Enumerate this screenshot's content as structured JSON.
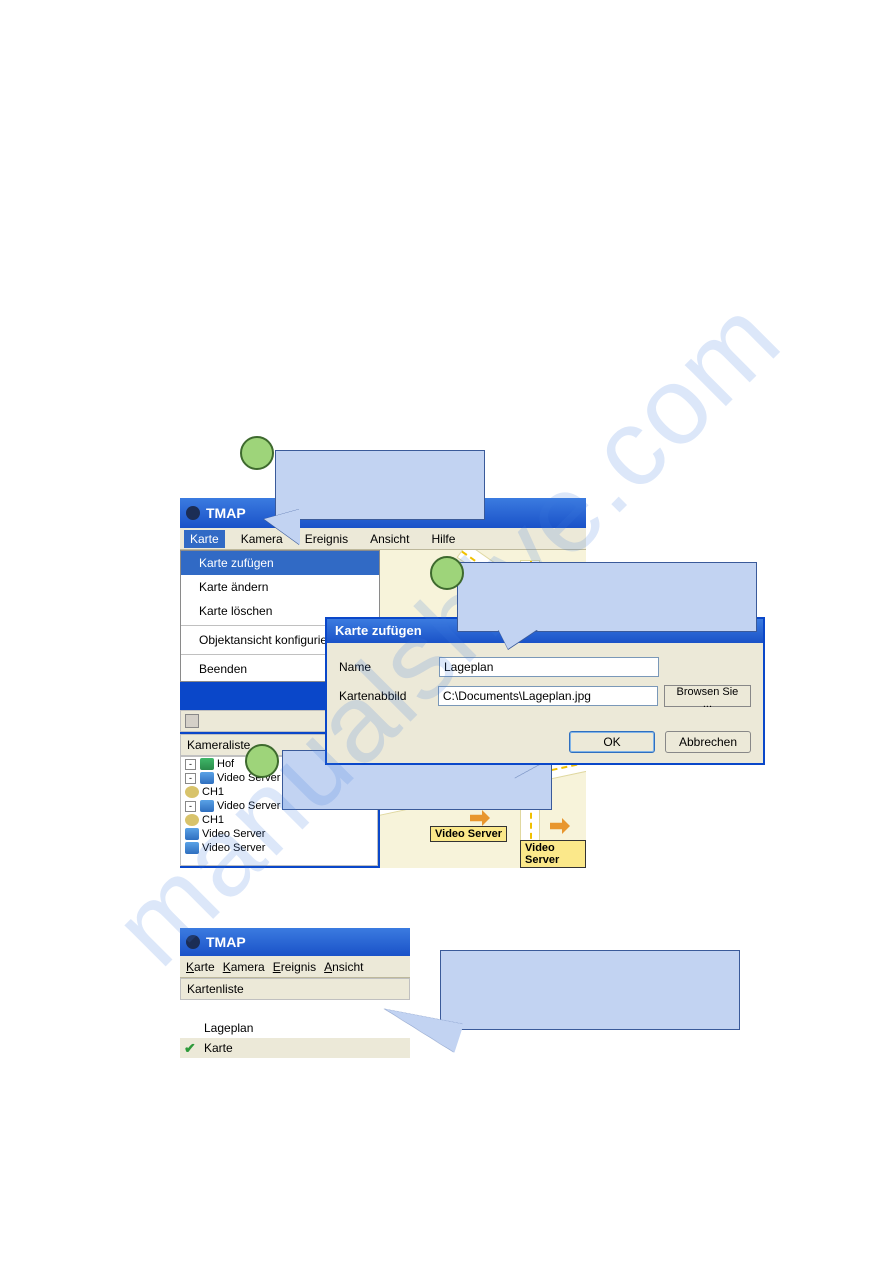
{
  "watermark": "manualshive.com",
  "main_window": {
    "title": "TMAP",
    "menubar": [
      "Karte",
      "Kamera",
      "Ereignis",
      "Ansicht",
      "Hilfe"
    ],
    "selected_menu_index": 0,
    "dropdown": {
      "items": [
        "Karte zufügen",
        "Karte ändern",
        "Karte löschen"
      ],
      "extra": [
        "Objektansicht konfigurieren",
        "Beenden"
      ],
      "selected_index": 0
    },
    "kameraliste_label": "Kameraliste",
    "tree": {
      "root": "Hof",
      "nodes": [
        {
          "label": "Video Server",
          "children": [
            "CH1"
          ]
        },
        {
          "label": "Video Server",
          "children": [
            "CH1"
          ]
        },
        {
          "label": "Video Server",
          "children": []
        },
        {
          "label": "Video Server",
          "children": []
        }
      ]
    },
    "map_labels": [
      "Video Server",
      "Video Server"
    ]
  },
  "dialog": {
    "title": "Karte zufügen",
    "rows": {
      "name_label": "Name",
      "name_value": "Lageplan",
      "image_label": "Kartenabbild",
      "image_value": "C:\\Documents\\Lageplan.jpg"
    },
    "browse": "Browsen Sie ...",
    "ok": "OK",
    "cancel": "Abbrechen"
  },
  "win2": {
    "title": "TMAP",
    "menubar": [
      "Karte",
      "Kamera",
      "Ereignis",
      "Ansicht"
    ],
    "pane_header": "Kartenliste",
    "items": [
      "Lageplan",
      "Karte"
    ],
    "active_index": 1
  },
  "callouts": {
    "c1": "",
    "c2": "",
    "c3": "",
    "c4": ""
  }
}
